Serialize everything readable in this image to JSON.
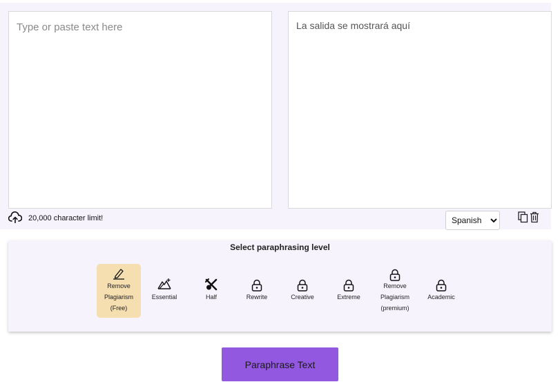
{
  "input": {
    "placeholder": "Type or paste text here",
    "char_limit": "20,000 character limit!"
  },
  "output": {
    "placeholder_text": "La salida se mostrará aquí"
  },
  "language": {
    "selected": "Spanish",
    "options": [
      "Spanish"
    ]
  },
  "levels": {
    "title": "Select paraphrasing level",
    "items": [
      {
        "label": "Remove\nPlagiarism\n(Free)",
        "icon": "pen-icon",
        "active": true
      },
      {
        "label": "Essential",
        "icon": "mountain-sparkle-icon",
        "active": false
      },
      {
        "label": "Half",
        "icon": "crossed-tools-icon",
        "active": false
      },
      {
        "label": "Rewrite",
        "icon": "lock-icon",
        "active": false
      },
      {
        "label": "Creative",
        "icon": "lock-icon",
        "active": false
      },
      {
        "label": "Extreme",
        "icon": "lock-icon",
        "active": false
      },
      {
        "label": "Remove\nPlagiarism\n(premium)",
        "icon": "lock-icon",
        "active": false
      },
      {
        "label": "Academic",
        "icon": "lock-icon",
        "active": false
      }
    ]
  },
  "actions": {
    "paraphrase_label": "Paraphrase Text"
  },
  "colors": {
    "panel_bg": "#f6f3fd",
    "active_level": "#f5deb0",
    "button": "#9358e0"
  }
}
